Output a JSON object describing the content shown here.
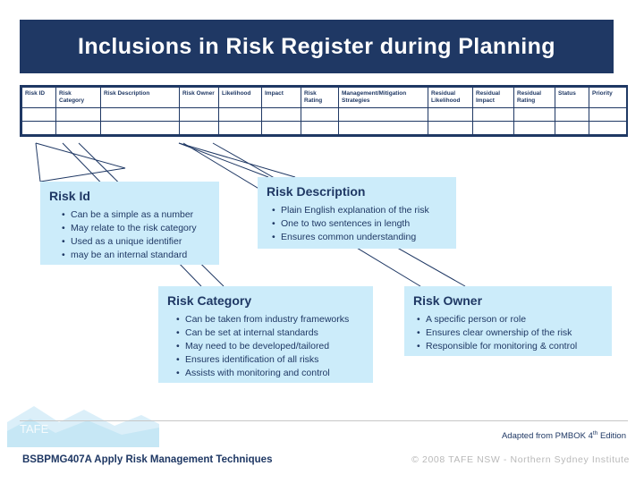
{
  "slide": {
    "title": "Inclusions in Risk Register during Planning"
  },
  "register_table": {
    "columns": [
      "Risk ID",
      "Risk Category",
      "Risk Description",
      "Risk Owner",
      "Likelihood",
      "Impact",
      "Risk Rating",
      "Management/Mitigation Strategies",
      "Residual Likelihood",
      "Residual Impact",
      "Residual Rating",
      "Status",
      "Priority"
    ],
    "empty_rows": 2
  },
  "callouts": [
    {
      "id": "risk-id",
      "heading": "Risk Id",
      "bullets": [
        "Can be a simple as a number",
        "May relate to the risk category",
        "Used as a unique identifier",
        "may be an internal standard"
      ]
    },
    {
      "id": "risk-description",
      "heading": "Risk Description",
      "bullets": [
        "Plain English explanation of the risk",
        "One to two sentences in length",
        "Ensures common understanding"
      ]
    },
    {
      "id": "risk-category",
      "heading": "Risk Category",
      "bullets": [
        "Can be taken from industry frameworks",
        "Can be set at internal standards",
        "May need to be developed/tailored",
        "Ensures identification of all risks",
        "Assists with monitoring and control"
      ]
    },
    {
      "id": "risk-owner",
      "heading": "Risk Owner",
      "bullets": [
        "A specific person or role",
        "Ensures clear ownership of the risk",
        "Responsible for monitoring & control"
      ]
    }
  ],
  "footer": {
    "adapted_main": "Adapted from PMBOK 4",
    "adapted_sup": "th",
    "adapted_tail": " Edition",
    "course": "BSBPMG407A Apply Risk Management Techniques",
    "copyright": "© 2008 TAFE NSW - Northern Sydney Institute"
  },
  "colors": {
    "navy": "#1f3864",
    "callout_fill": "#ccecfa",
    "white": "#ffffff"
  }
}
